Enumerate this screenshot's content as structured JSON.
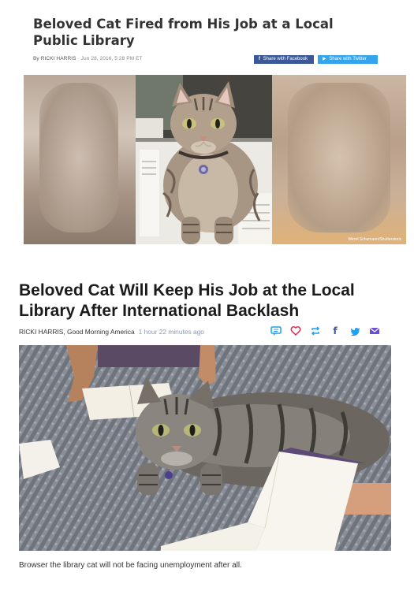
{
  "article1": {
    "headline": "Beloved Cat Fired from His Job at a Local Public Library",
    "author": "By RICKI HARRIS",
    "date": "Jun 28, 2016, 5:28 PM ET",
    "facebook_label": "Share with Facebook",
    "twitter_label": "Share with Twitter",
    "photo_credit": "Wirrel Schumann/Shutterstock"
  },
  "article2": {
    "headline": "Beloved Cat Will Keep His Job at the Local Library After International Backlash",
    "byline": "RICKI HARRIS, Good Morning America",
    "time_ago": "1 hour 22 minutes ago",
    "caption": "Browser the library cat will not be facing unemployment after all."
  },
  "icons": [
    "comment-icon",
    "heart-icon",
    "retweet-icon",
    "facebook-icon",
    "twitter-icon",
    "email-icon"
  ],
  "colors": {
    "facebook": "#3b5998",
    "twitter": "#34a4ec",
    "icon_blue": "#1da1f2",
    "heart": "#e2264d"
  }
}
